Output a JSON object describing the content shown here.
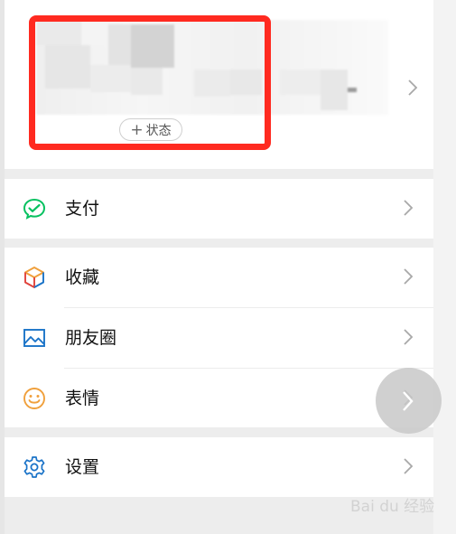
{
  "profile": {
    "status_plus": "+",
    "status_label": "状态"
  },
  "menu": {
    "pay": {
      "label": "支付",
      "icon": "wechat-pay-icon"
    },
    "favorites": {
      "label": "收藏",
      "icon": "cube-icon"
    },
    "moments": {
      "label": "朋友圈",
      "icon": "image-icon"
    },
    "stickers": {
      "label": "表情",
      "icon": "smiley-icon"
    },
    "settings": {
      "label": "设置",
      "icon": "gear-icon"
    }
  },
  "watermark": {
    "text": "Bai du 经验"
  },
  "colors": {
    "highlight": "#ff2a20",
    "pay_green": "#07c160",
    "blue": "#1a73c8",
    "orange": "#f0a03c",
    "background": "#ededed"
  }
}
